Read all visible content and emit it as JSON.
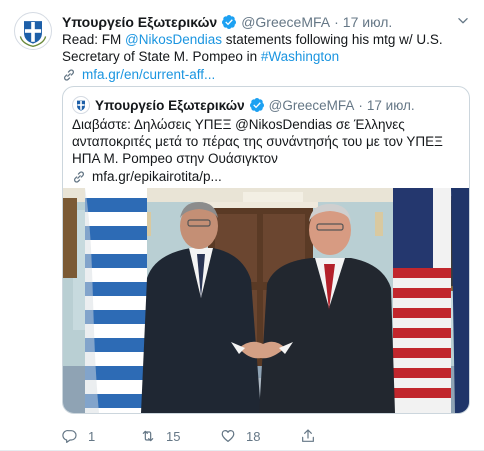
{
  "tweet": {
    "author_name": "Υπουργείο Εξωτερικών",
    "handle": "@GreeceMFA",
    "dot": "·",
    "time": "17 июл.",
    "text_prefix": "Read: FM ",
    "mention": "@NikosDendias",
    "text_mid": " statements following his mtg w/ U.S. Secretary of State M. Pompeo in ",
    "hashtag": "#Washington",
    "link_text": "mfa.gr/en/current-aff..."
  },
  "quoted": {
    "author_name": "Υπουργείο Εξωτερικών",
    "handle": "@GreeceMFA",
    "dot": "·",
    "time": "17 июл.",
    "text": "Διαβάστε: Δηλώσεις ΥΠΕΞ @NikosDendias σε Έλληνες ανταποκριτές μετά το πέρας της συνάντησής του με τον ΥΠΕΞ ΗΠΑ Μ. Pompeo στην Ουάσιγκτον",
    "link_text": "mfa.gr/epikairotita/p..."
  },
  "actions": {
    "reply_count": "1",
    "retweet_count": "15",
    "like_count": "18"
  },
  "colors": {
    "link": "#1b95e0",
    "muted": "#657786",
    "verified": "#1da1f2"
  },
  "icons": [
    "coat-of-arms-icon",
    "verified-badge-icon",
    "chevron-down-icon",
    "link-icon",
    "reply-icon",
    "retweet-icon",
    "like-icon",
    "share-icon"
  ]
}
